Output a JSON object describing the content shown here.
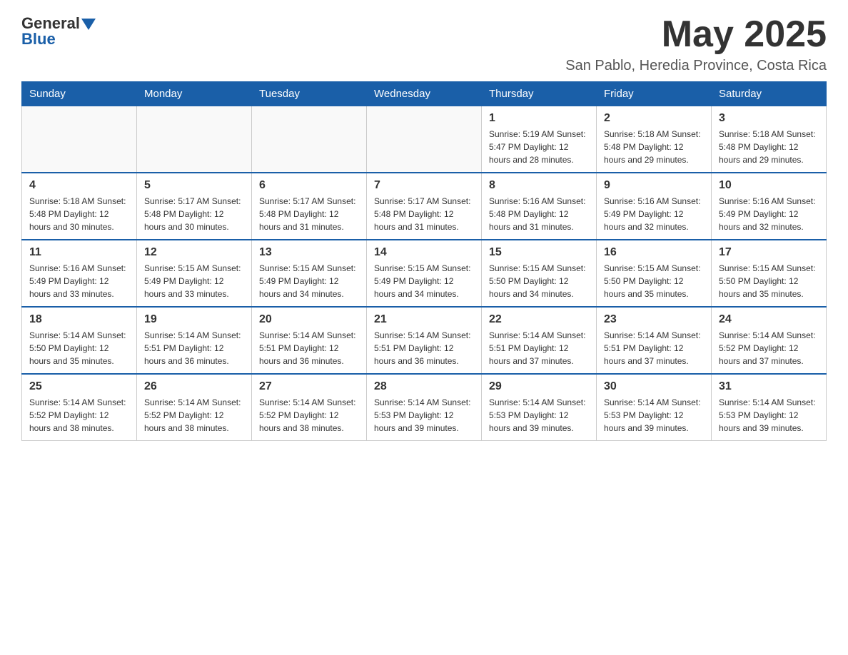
{
  "header": {
    "logo_general": "General",
    "logo_blue": "Blue",
    "month_title": "May 2025",
    "location": "San Pablo, Heredia Province, Costa Rica"
  },
  "calendar": {
    "days_of_week": [
      "Sunday",
      "Monday",
      "Tuesday",
      "Wednesday",
      "Thursday",
      "Friday",
      "Saturday"
    ],
    "weeks": [
      [
        {
          "day": "",
          "info": ""
        },
        {
          "day": "",
          "info": ""
        },
        {
          "day": "",
          "info": ""
        },
        {
          "day": "",
          "info": ""
        },
        {
          "day": "1",
          "info": "Sunrise: 5:19 AM\nSunset: 5:47 PM\nDaylight: 12 hours and 28 minutes."
        },
        {
          "day": "2",
          "info": "Sunrise: 5:18 AM\nSunset: 5:48 PM\nDaylight: 12 hours and 29 minutes."
        },
        {
          "day": "3",
          "info": "Sunrise: 5:18 AM\nSunset: 5:48 PM\nDaylight: 12 hours and 29 minutes."
        }
      ],
      [
        {
          "day": "4",
          "info": "Sunrise: 5:18 AM\nSunset: 5:48 PM\nDaylight: 12 hours and 30 minutes."
        },
        {
          "day": "5",
          "info": "Sunrise: 5:17 AM\nSunset: 5:48 PM\nDaylight: 12 hours and 30 minutes."
        },
        {
          "day": "6",
          "info": "Sunrise: 5:17 AM\nSunset: 5:48 PM\nDaylight: 12 hours and 31 minutes."
        },
        {
          "day": "7",
          "info": "Sunrise: 5:17 AM\nSunset: 5:48 PM\nDaylight: 12 hours and 31 minutes."
        },
        {
          "day": "8",
          "info": "Sunrise: 5:16 AM\nSunset: 5:48 PM\nDaylight: 12 hours and 31 minutes."
        },
        {
          "day": "9",
          "info": "Sunrise: 5:16 AM\nSunset: 5:49 PM\nDaylight: 12 hours and 32 minutes."
        },
        {
          "day": "10",
          "info": "Sunrise: 5:16 AM\nSunset: 5:49 PM\nDaylight: 12 hours and 32 minutes."
        }
      ],
      [
        {
          "day": "11",
          "info": "Sunrise: 5:16 AM\nSunset: 5:49 PM\nDaylight: 12 hours and 33 minutes."
        },
        {
          "day": "12",
          "info": "Sunrise: 5:15 AM\nSunset: 5:49 PM\nDaylight: 12 hours and 33 minutes."
        },
        {
          "day": "13",
          "info": "Sunrise: 5:15 AM\nSunset: 5:49 PM\nDaylight: 12 hours and 34 minutes."
        },
        {
          "day": "14",
          "info": "Sunrise: 5:15 AM\nSunset: 5:49 PM\nDaylight: 12 hours and 34 minutes."
        },
        {
          "day": "15",
          "info": "Sunrise: 5:15 AM\nSunset: 5:50 PM\nDaylight: 12 hours and 34 minutes."
        },
        {
          "day": "16",
          "info": "Sunrise: 5:15 AM\nSunset: 5:50 PM\nDaylight: 12 hours and 35 minutes."
        },
        {
          "day": "17",
          "info": "Sunrise: 5:15 AM\nSunset: 5:50 PM\nDaylight: 12 hours and 35 minutes."
        }
      ],
      [
        {
          "day": "18",
          "info": "Sunrise: 5:14 AM\nSunset: 5:50 PM\nDaylight: 12 hours and 35 minutes."
        },
        {
          "day": "19",
          "info": "Sunrise: 5:14 AM\nSunset: 5:51 PM\nDaylight: 12 hours and 36 minutes."
        },
        {
          "day": "20",
          "info": "Sunrise: 5:14 AM\nSunset: 5:51 PM\nDaylight: 12 hours and 36 minutes."
        },
        {
          "day": "21",
          "info": "Sunrise: 5:14 AM\nSunset: 5:51 PM\nDaylight: 12 hours and 36 minutes."
        },
        {
          "day": "22",
          "info": "Sunrise: 5:14 AM\nSunset: 5:51 PM\nDaylight: 12 hours and 37 minutes."
        },
        {
          "day": "23",
          "info": "Sunrise: 5:14 AM\nSunset: 5:51 PM\nDaylight: 12 hours and 37 minutes."
        },
        {
          "day": "24",
          "info": "Sunrise: 5:14 AM\nSunset: 5:52 PM\nDaylight: 12 hours and 37 minutes."
        }
      ],
      [
        {
          "day": "25",
          "info": "Sunrise: 5:14 AM\nSunset: 5:52 PM\nDaylight: 12 hours and 38 minutes."
        },
        {
          "day": "26",
          "info": "Sunrise: 5:14 AM\nSunset: 5:52 PM\nDaylight: 12 hours and 38 minutes."
        },
        {
          "day": "27",
          "info": "Sunrise: 5:14 AM\nSunset: 5:52 PM\nDaylight: 12 hours and 38 minutes."
        },
        {
          "day": "28",
          "info": "Sunrise: 5:14 AM\nSunset: 5:53 PM\nDaylight: 12 hours and 39 minutes."
        },
        {
          "day": "29",
          "info": "Sunrise: 5:14 AM\nSunset: 5:53 PM\nDaylight: 12 hours and 39 minutes."
        },
        {
          "day": "30",
          "info": "Sunrise: 5:14 AM\nSunset: 5:53 PM\nDaylight: 12 hours and 39 minutes."
        },
        {
          "day": "31",
          "info": "Sunrise: 5:14 AM\nSunset: 5:53 PM\nDaylight: 12 hours and 39 minutes."
        }
      ]
    ]
  }
}
